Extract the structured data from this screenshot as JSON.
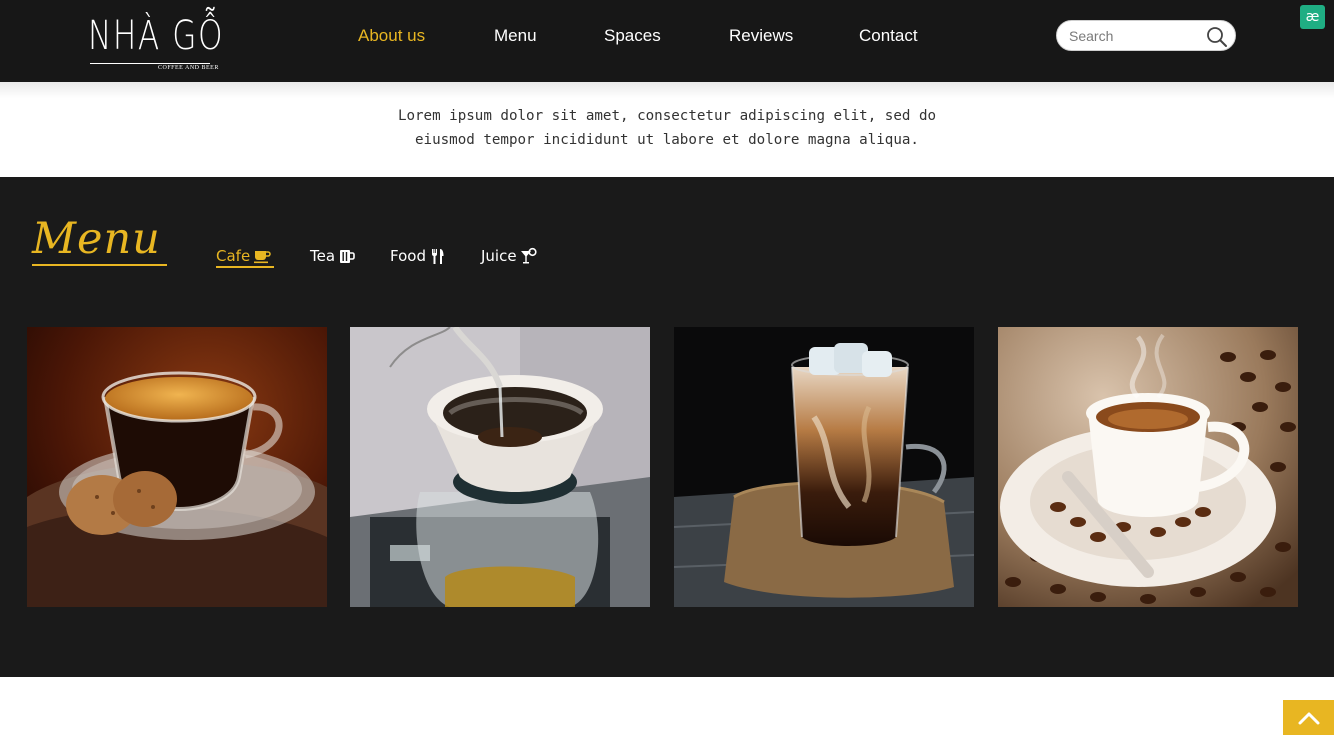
{
  "header": {
    "logo_text": "NHÀ GỖ",
    "logo_subtext": "COFFEE AND BEER",
    "nav": [
      {
        "label": "About us",
        "active": true
      },
      {
        "label": "Menu",
        "active": false
      },
      {
        "label": "Spaces",
        "active": false
      },
      {
        "label": "Reviews",
        "active": false
      },
      {
        "label": "Contact",
        "active": false
      }
    ],
    "search_placeholder": "Search",
    "badge_glyph": "æ"
  },
  "intro": {
    "text": "Lorem ipsum dolor sit amet, consectetur adipiscing elit, sed do eiusmod tempor incididunt ut labore et dolore magna aliqua."
  },
  "menu": {
    "title": "Menu",
    "tabs": [
      {
        "label": "Cafe",
        "icon": "coffee-cup-icon",
        "active": true
      },
      {
        "label": "Tea",
        "icon": "beer-mug-icon",
        "active": false
      },
      {
        "label": "Food",
        "icon": "fork-knife-icon",
        "active": false
      },
      {
        "label": "Juice",
        "icon": "cocktail-icon",
        "active": false
      }
    ],
    "items": [
      {
        "image": "espresso-cup-with-cookies"
      },
      {
        "image": "pour-over-coffee-dripper"
      },
      {
        "image": "iced-milk-coffee-glass"
      },
      {
        "image": "coffee-cup-with-beans"
      }
    ]
  },
  "colors": {
    "accent": "#e8b622",
    "header_bg": "#171717",
    "section_bg": "#1a1a1a",
    "badge": "#1fae83"
  }
}
